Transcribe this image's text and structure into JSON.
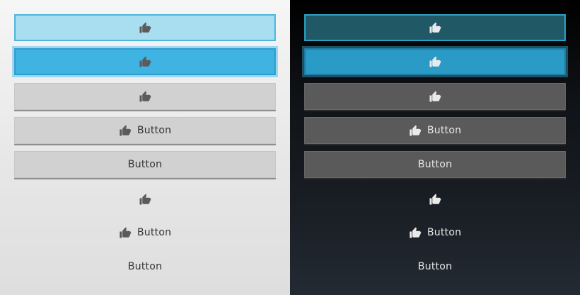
{
  "icons": {
    "like": "thumbs-up-icon"
  },
  "colors": {
    "light_blue_fill": "#a9ddf0",
    "blue_fill": "#3fb4e3",
    "gray_fill": "#d1d1d1",
    "dark_blue_fill": "#205866",
    "dark_blue_active": "#2a9ac6",
    "dark_gray_fill": "#5a5a5a"
  },
  "light": {
    "buttons": [
      {
        "variant": "light-blue",
        "label": ""
      },
      {
        "variant": "blue",
        "label": ""
      },
      {
        "variant": "gray",
        "label": ""
      },
      {
        "variant": "gray-text-icon",
        "label": "Button"
      },
      {
        "variant": "gray-text",
        "label": "Button"
      },
      {
        "variant": "flat-icon",
        "label": ""
      },
      {
        "variant": "flat-icon-text",
        "label": "Button"
      },
      {
        "variant": "flat-text",
        "label": "Button"
      }
    ]
  },
  "dark": {
    "buttons": [
      {
        "variant": "light-blue",
        "label": ""
      },
      {
        "variant": "blue",
        "label": ""
      },
      {
        "variant": "gray",
        "label": ""
      },
      {
        "variant": "gray-text-icon",
        "label": "Button"
      },
      {
        "variant": "gray-text",
        "label": "Button"
      },
      {
        "variant": "flat-icon",
        "label": ""
      },
      {
        "variant": "flat-icon-text",
        "label": "Button"
      },
      {
        "variant": "flat-text",
        "label": "Button"
      }
    ]
  }
}
